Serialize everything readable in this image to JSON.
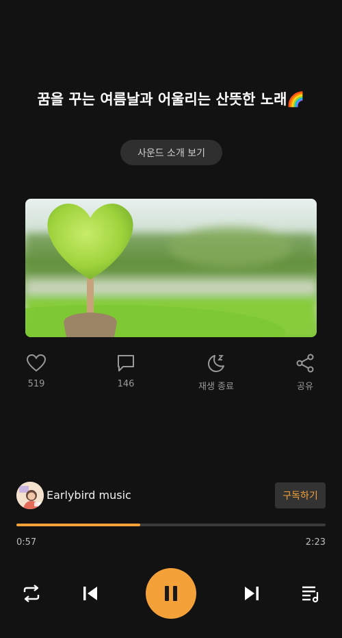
{
  "track": {
    "title": "꿈을 꾸는 여름날과 어울리는 산뜻한 노래🌈",
    "intro_button": "사운드 소개 보기"
  },
  "actions": {
    "like_count": "519",
    "comment_count": "146",
    "sleep_timer_label": "재생 종료",
    "share_label": "공유"
  },
  "channel": {
    "name": "Earlybird music",
    "subscribe_label": "구독하기"
  },
  "player": {
    "current_time": "0:57",
    "total_time": "2:23",
    "progress": 0.4
  },
  "icons": [
    "heart-icon",
    "comment-icon",
    "moon-sleep-icon",
    "share-icon",
    "repeat-icon",
    "previous-icon",
    "pause-icon",
    "next-icon",
    "playlist-icon"
  ],
  "colors": {
    "accent": "#f5a13a",
    "background": "#121212"
  }
}
